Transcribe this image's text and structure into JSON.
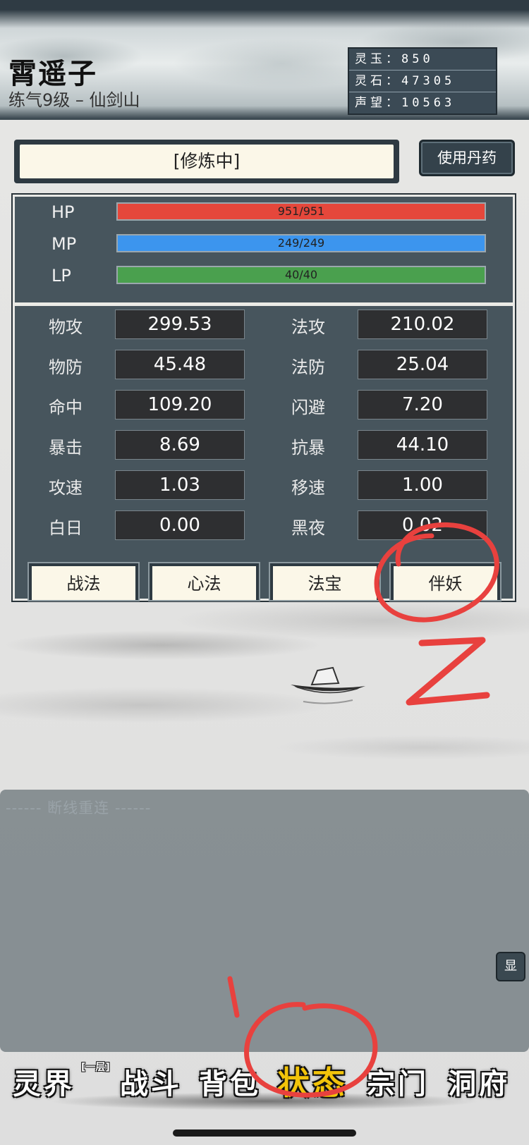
{
  "character": {
    "name": "霄遥子",
    "subtitle": "练气9级 – 仙剑山"
  },
  "resources": [
    {
      "label": "灵玉：850"
    },
    {
      "label": "灵石：47305"
    },
    {
      "label": "声望：10563"
    }
  ],
  "status": {
    "text": "[修炼中]",
    "use_button": "使用丹药"
  },
  "bars": [
    {
      "label": "HP",
      "text": "951/951",
      "fraction": 1.0,
      "color": "#e5473b"
    },
    {
      "label": "MP",
      "text": "249/249",
      "fraction": 1.0,
      "color": "#3c95ee"
    },
    {
      "label": "LP",
      "text": "40/40",
      "fraction": 1.0,
      "color": "#4aa04e"
    }
  ],
  "stats_left": [
    {
      "label": "物攻",
      "value": "299.53"
    },
    {
      "label": "物防",
      "value": "45.48"
    },
    {
      "label": "命中",
      "value": "109.20"
    },
    {
      "label": "暴击",
      "value": "8.69"
    },
    {
      "label": "攻速",
      "value": "1.03"
    },
    {
      "label": "白日",
      "value": "0.00"
    }
  ],
  "stats_right": [
    {
      "label": "法攻",
      "value": "210.02"
    },
    {
      "label": "法防",
      "value": "25.04"
    },
    {
      "label": "闪避",
      "value": "7.20"
    },
    {
      "label": "抗暴",
      "value": "44.10"
    },
    {
      "label": "移速",
      "value": "1.00"
    },
    {
      "label": "黑夜",
      "value": "0.02"
    }
  ],
  "tabs": [
    "战法",
    "心法",
    "法宝",
    "伴妖"
  ],
  "chat": {
    "message": "------ 断线重连 ------",
    "show_button": "显"
  },
  "nav": {
    "items": [
      "灵界",
      "战斗",
      "背包",
      "状态",
      "宗门",
      "洞府"
    ],
    "badge": "[一层]",
    "active": "状态"
  },
  "annotation": {
    "letter": "Z",
    "color": "#e8413e"
  }
}
